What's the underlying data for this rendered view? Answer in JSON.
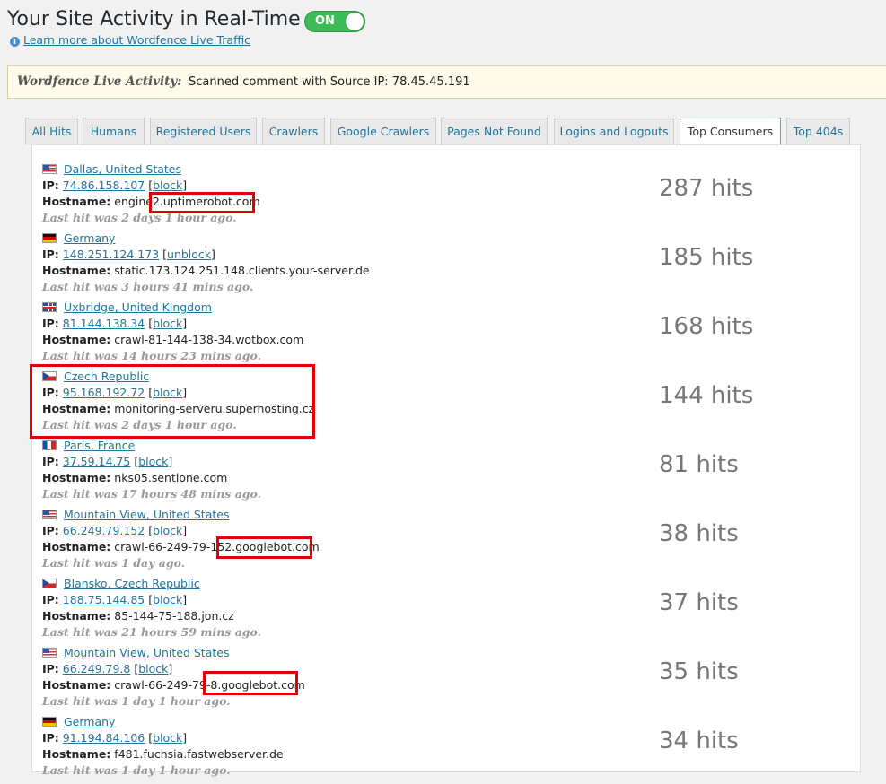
{
  "header": {
    "title": "Your Site Activity in Real-Time",
    "toggle_label": "ON",
    "learn_link": "Learn more about Wordfence Live Traffic"
  },
  "activity": {
    "label": "Wordfence Live Activity:",
    "text": "Scanned comment with Source IP: 78.45.45.191"
  },
  "tabs": [
    "All Hits",
    "Humans",
    "Registered Users",
    "Crawlers",
    "Google Crawlers",
    "Pages Not Found",
    "Logins and Logouts",
    "Top Consumers",
    "Top 404s"
  ],
  "active_tab": "Top Consumers",
  "labels": {
    "ip": "IP:",
    "hostname": "Hostname:"
  },
  "entries": [
    {
      "flag": "us",
      "location": "Dallas, United States",
      "ip": "74.86.158.107",
      "action": "block",
      "hostname": "engine2.uptimerobot.com",
      "last_hit": "Last hit was 2 days 1 hour ago.",
      "hits": "287 hits"
    },
    {
      "flag": "de",
      "location": "Germany",
      "ip": "148.251.124.173",
      "action": "unblock",
      "hostname": "static.173.124.251.148.clients.your-server.de",
      "last_hit": "Last hit was 3 hours 41 mins ago.",
      "hits": "185 hits"
    },
    {
      "flag": "gb",
      "location": "Uxbridge, United Kingdom",
      "ip": "81.144.138.34",
      "action": "block",
      "hostname": "crawl-81-144-138-34.wotbox.com",
      "last_hit": "Last hit was 14 hours 23 mins ago.",
      "hits": "168 hits"
    },
    {
      "flag": "cz",
      "location": "Czech Republic",
      "ip": "95.168.192.72",
      "action": "block",
      "hostname": "monitoring-serveru.superhosting.cz",
      "last_hit": "Last hit was 2 days 1 hour ago.",
      "hits": "144 hits"
    },
    {
      "flag": "fr",
      "location": "Paris, France",
      "ip": "37.59.14.75",
      "action": "block",
      "hostname": "nks05.sentione.com",
      "last_hit": "Last hit was 17 hours 48 mins ago.",
      "hits": "81 hits"
    },
    {
      "flag": "us",
      "location": "Mountain View, United States",
      "ip": "66.249.79.152",
      "action": "block",
      "hostname": "crawl-66-249-79-152.googlebot.com",
      "last_hit": "Last hit was 1 day ago.",
      "hits": "38 hits"
    },
    {
      "flag": "cz",
      "location": "Blansko, Czech Republic",
      "ip": "188.75.144.85",
      "action": "block",
      "hostname": "85-144-75-188.jon.cz",
      "last_hit": "Last hit was 21 hours 59 mins ago.",
      "hits": "37 hits"
    },
    {
      "flag": "us",
      "location": "Mountain View, United States",
      "ip": "66.249.79.8",
      "action": "block",
      "hostname": "crawl-66-249-79-8.googlebot.com",
      "last_hit": "Last hit was 1 day 1 hour ago.",
      "hits": "35 hits"
    },
    {
      "flag": "de",
      "location": "Germany",
      "ip": "91.194.84.106",
      "action": "block",
      "hostname": "f481.fuchsia.fastwebserver.de",
      "last_hit": "Last hit was 1 day 1 hour ago.",
      "hits": "34 hits"
    }
  ]
}
